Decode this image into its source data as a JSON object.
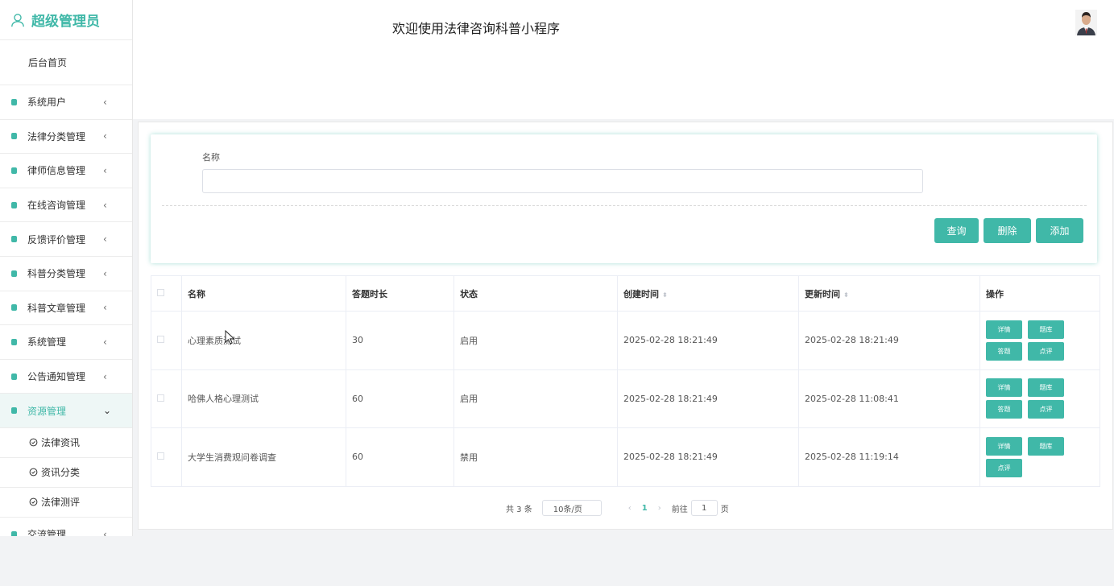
{
  "sidebar": {
    "brand": "超级管理员",
    "home": "后台首页",
    "items": [
      {
        "label": "系统用户"
      },
      {
        "label": "法律分类管理"
      },
      {
        "label": "律师信息管理"
      },
      {
        "label": "在线咨询管理"
      },
      {
        "label": "反馈评价管理"
      },
      {
        "label": "科普分类管理"
      },
      {
        "label": "科普文章管理"
      },
      {
        "label": "系统管理"
      },
      {
        "label": "公告通知管理"
      },
      {
        "label": "资源管理"
      }
    ],
    "sub_items": [
      {
        "label": "法律资讯"
      },
      {
        "label": "资讯分类"
      },
      {
        "label": "法律测评"
      }
    ],
    "last_item": "交流管理",
    "chevron": "‹",
    "chevron_open": "⌄"
  },
  "header": {
    "welcome": "欢迎使用法律咨询科普小程序"
  },
  "search": {
    "label": "名称",
    "value": "",
    "buttons": {
      "query": "查询",
      "delete": "删除",
      "add": "添加"
    }
  },
  "table": {
    "columns": [
      "名称",
      "答题时长",
      "状态",
      "创建时间",
      "更新时间",
      "操作"
    ],
    "rows": [
      {
        "name": "心理素质测试",
        "duration": "30",
        "status": "启用",
        "created": "2025-02-28 18:21:49",
        "updated": "2025-02-28 18:21:49",
        "ops": [
          "详情",
          "题库",
          "答题",
          "点评"
        ]
      },
      {
        "name": "哈佛人格心理测试",
        "duration": "60",
        "status": "启用",
        "created": "2025-02-28 18:21:49",
        "updated": "2025-02-28 11:08:41",
        "ops": [
          "详情",
          "题库",
          "答题",
          "点评"
        ]
      },
      {
        "name": "大学生消费观问卷调查",
        "duration": "60",
        "status": "禁用",
        "created": "2025-02-28 18:21:49",
        "updated": "2025-02-28 11:19:14",
        "ops": [
          "详情",
          "题库",
          "点评"
        ]
      }
    ]
  },
  "pagination": {
    "total": "共 3 条",
    "page_size": "10条/页",
    "prev": "‹",
    "current": "1",
    "next": "›",
    "goto_label": "前往",
    "goto_value": "1",
    "page_unit": "页"
  },
  "colors": {
    "accent": "#40b8a8"
  }
}
